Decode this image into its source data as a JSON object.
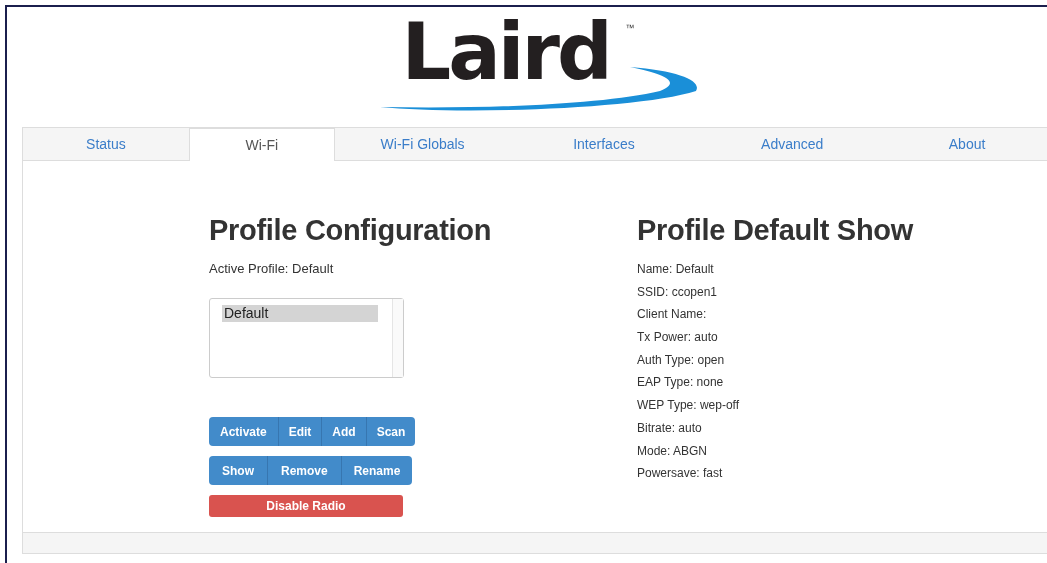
{
  "logo": {
    "name": "Laird",
    "mark": "™"
  },
  "tabs": [
    {
      "label": "Status",
      "selected": false
    },
    {
      "label": "Wi-Fi",
      "selected": true
    },
    {
      "label": "Wi-Fi Globals",
      "selected": false
    },
    {
      "label": "Interfaces",
      "selected": false
    },
    {
      "label": "Advanced",
      "selected": false
    },
    {
      "label": "About",
      "selected": false
    }
  ],
  "profile_configuration": {
    "title": "Profile Configuration",
    "active_profile": "Active Profile: Default",
    "profiles": [
      {
        "label": "Default",
        "selected": true
      }
    ],
    "button_rows": [
      [
        {
          "label": "Activate",
          "kind": "primary"
        },
        {
          "label": "Edit",
          "kind": "primary"
        },
        {
          "label": "Add",
          "kind": "primary"
        },
        {
          "label": "Scan",
          "kind": "primary"
        }
      ],
      [
        {
          "label": "Show",
          "kind": "primary"
        },
        {
          "label": "Remove",
          "kind": "primary"
        },
        {
          "label": "Rename",
          "kind": "primary"
        }
      ],
      [
        {
          "label": "Disable Radio",
          "kind": "danger"
        }
      ]
    ]
  },
  "profile_show": {
    "title": "Profile Default Show",
    "fields": [
      "Name: Default",
      "SSID: ccopen1",
      "Client Name:",
      "Tx Power: auto",
      "Auth Type: open",
      "EAP Type: none",
      "WEP Type: wep-off",
      "Bitrate: auto",
      "Mode: ABGN",
      "Powersave: fast"
    ]
  }
}
